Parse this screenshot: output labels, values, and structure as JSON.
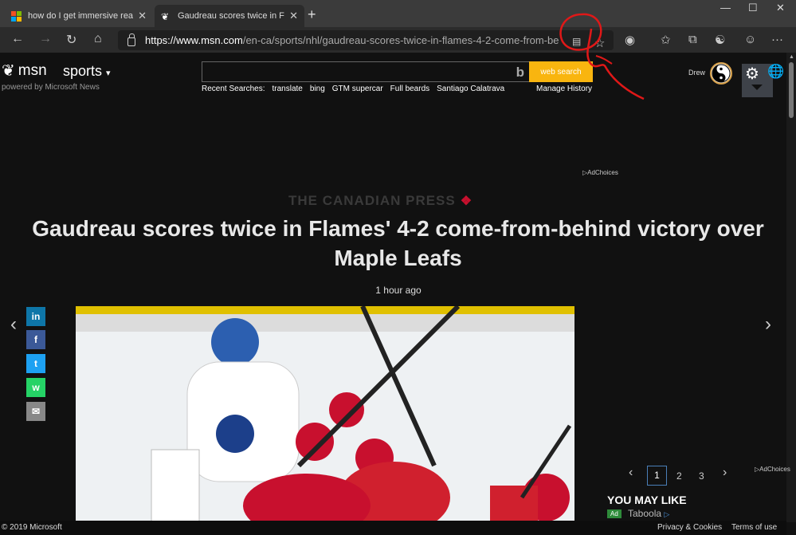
{
  "browser": {
    "tabs": [
      {
        "title": "how do I get immersive reader to",
        "active": false
      },
      {
        "title": "Gaudreau scores twice in Flames",
        "active": true
      }
    ],
    "new_tab": "+",
    "url": {
      "scheme": "https://",
      "host": "www.msn.com",
      "path": "/en-ca/sports/nhl/gaudreau-scores-twice-in-flames-4-2-come-from-be..."
    }
  },
  "msn": {
    "logo_text": "msn",
    "section": "sports",
    "powered_by": "powered by Microsoft News",
    "search": {
      "placeholder": "",
      "button": "web search",
      "recent_label": "Recent Searches:",
      "recent": [
        "translate",
        "bing",
        "GTM supercar",
        "Full beards",
        "Santiago Calatrava"
      ],
      "manage": "Manage History"
    },
    "user": "Drew"
  },
  "article": {
    "adchoices": "AdChoices",
    "source": "THE CANADIAN PRESS",
    "headline": "Gaudreau scores twice in Flames' 4-2 come-from-behind victory over Maple Leafs",
    "time": "1 hour ago"
  },
  "share": [
    {
      "name": "linkedin",
      "label": "in",
      "color": "#0e76a8"
    },
    {
      "name": "facebook",
      "label": "f",
      "color": "#3b5998"
    },
    {
      "name": "twitter",
      "label": "t",
      "color": "#1da1f2"
    },
    {
      "name": "whatsapp",
      "label": "w",
      "color": "#25d366"
    },
    {
      "name": "email",
      "label": "✉",
      "color": "#888888"
    }
  ],
  "rail": {
    "pages": [
      "1",
      "2",
      "3"
    ],
    "adchoices": "AdChoices",
    "you_may_like": "YOU MAY LIKE",
    "ad_tag": "Ad",
    "provider": "Taboola"
  },
  "footer": {
    "copyright": "© 2019 Microsoft",
    "privacy": "Privacy & Cookies",
    "terms": "Terms of use"
  }
}
